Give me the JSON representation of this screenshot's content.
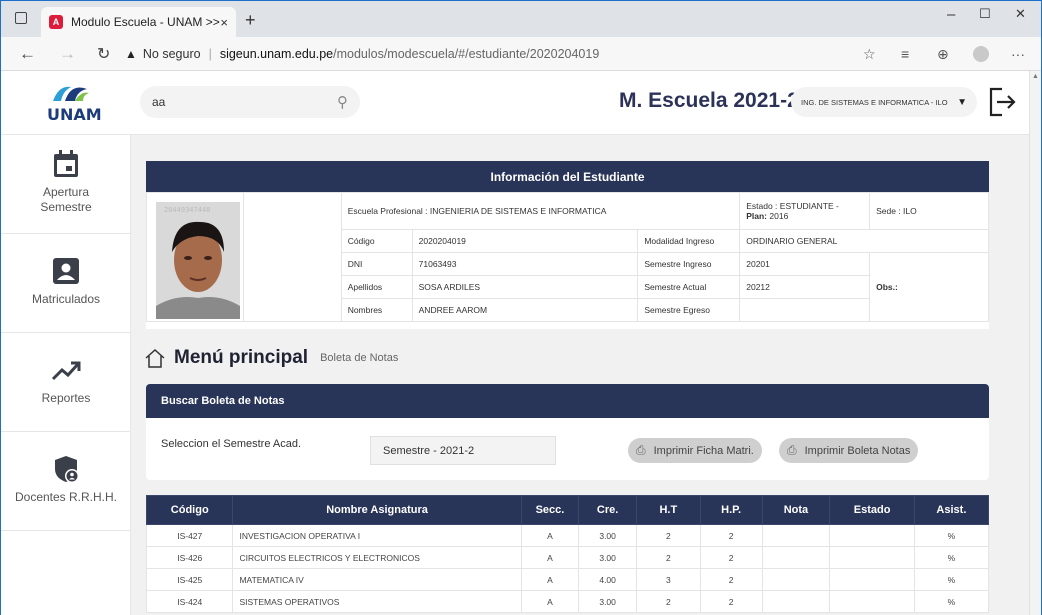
{
  "browser": {
    "tab_title": "Modulo Escuela - UNAM >>",
    "tab_close": "×",
    "new_tab": "+",
    "security": "No seguro",
    "url_domain": "sigeun.unam.edu.pe",
    "url_path": "/modulos/modescuela/#/estudiante/2020204019",
    "window_controls": [
      "–",
      "☐",
      "✕"
    ]
  },
  "header": {
    "logo_text": "UNAM",
    "search_value": "aa",
    "title": "M. Escuela 2021-2",
    "school_select": "ING. DE SISTEMAS E INFORMATICA - ILO"
  },
  "sidebar": {
    "items": [
      {
        "label": "Apertura Semestre",
        "icon": "calendar-icon"
      },
      {
        "label": "Matriculados",
        "icon": "user-badge-icon"
      },
      {
        "label": "Reportes",
        "icon": "trending-up-icon"
      },
      {
        "label": "Docentes R.R.H.H.",
        "icon": "shield-user-icon"
      }
    ]
  },
  "student": {
    "header": "Información del Estudiante",
    "escuela": "Escuela Profesional : INGENIERIA DE SISTEMAS E INFORMATICA",
    "estado": "Estado : ESTUDIANTE -",
    "plan_label": "Plan:",
    "plan_value": "2016",
    "sede": "Sede : ILO",
    "codigo_label": "Código",
    "codigo": "2020204019",
    "modalidad_label": "Modalidad Ingreso",
    "modalidad": "ORDINARIO GENERAL",
    "dni_label": "DNI",
    "dni": "71063493",
    "sem_ingreso_label": "Semestre Ingreso",
    "sem_ingreso": "20201",
    "apellidos_label": "Apellidos",
    "apellidos": "SOSA ARDILES",
    "sem_actual_label": "Semestre Actual",
    "sem_actual": "20212",
    "obs_label": "Obs.:",
    "nombres_label": "Nombres",
    "nombres": "ANDREE AAROM",
    "sem_egreso_label": "Semestre Egreso",
    "sem_egreso": "",
    "photo_stamp": "20449347448"
  },
  "menu": {
    "title": "Menú principal",
    "subtitle": "Boleta de Notas"
  },
  "buscar": {
    "header": "Buscar Boleta de Notas",
    "label": "Seleccion el Semestre Acad.",
    "semester": "Semestre - 2021-2",
    "btn_ficha": "Imprimir Ficha Matri.",
    "btn_boleta": "Imprimir Boleta Notas"
  },
  "grades": {
    "columns": [
      "Código",
      "Nombre Asignatura",
      "Secc.",
      "Cre.",
      "H.T",
      "H.P.",
      "Nota",
      "Estado",
      "Asist."
    ],
    "rows": [
      {
        "codigo": "IS-427",
        "nombre": "INVESTIGACION OPERATIVA I",
        "secc": "A",
        "cre": "3.00",
        "ht": "2",
        "hp": "2",
        "nota": "",
        "estado": "",
        "asist": "%"
      },
      {
        "codigo": "IS-426",
        "nombre": "CIRCUITOS ELECTRICOS Y ELECTRONICOS",
        "secc": "A",
        "cre": "3.00",
        "ht": "2",
        "hp": "2",
        "nota": "",
        "estado": "",
        "asist": "%"
      },
      {
        "codigo": "IS-425",
        "nombre": "MATEMATICA IV",
        "secc": "A",
        "cre": "4.00",
        "ht": "3",
        "hp": "2",
        "nota": "",
        "estado": "",
        "asist": "%"
      },
      {
        "codigo": "IS-424",
        "nombre": "SISTEMAS OPERATIVOS",
        "secc": "A",
        "cre": "3.00",
        "ht": "2",
        "hp": "2",
        "nota": "",
        "estado": "",
        "asist": "%"
      }
    ]
  },
  "colors": {
    "navy": "#293459",
    "brand_red": "#dd1b3a",
    "page_bg": "#f1f1f1"
  }
}
